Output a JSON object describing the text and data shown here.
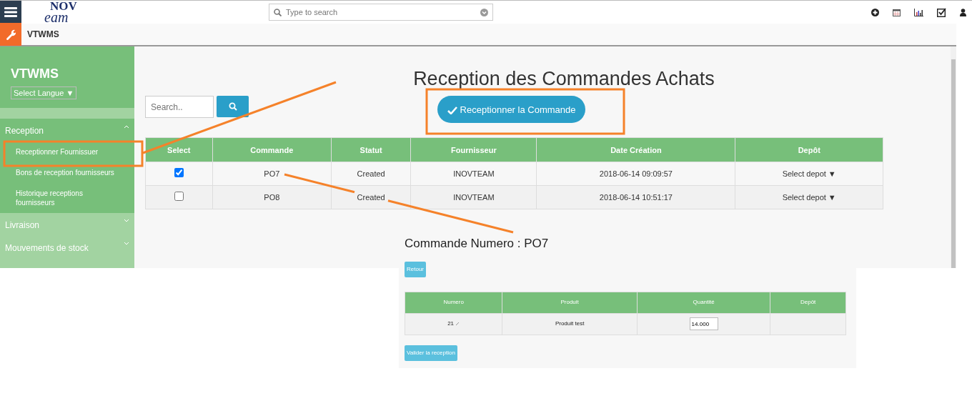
{
  "app": {
    "brand": "VTWMS",
    "logo_top": "NOV",
    "logo_bottom": "eam"
  },
  "search": {
    "placeholder": "Type to search"
  },
  "sidebar": {
    "title": "VTWMS",
    "language": "Select Langue ▼",
    "sections": [
      {
        "label": "Reception",
        "expanded": true,
        "children": [
          {
            "label": "Receptionner Fournissuer"
          },
          {
            "label": "Bons de reception fournisseurs"
          },
          {
            "label": "Historique receptions fournisseurs"
          }
        ]
      },
      {
        "label": "Livraison",
        "expanded": false
      },
      {
        "label": "Mouvements de stock",
        "expanded": false
      }
    ]
  },
  "page": {
    "title": "Reception des Commandes Achats",
    "search_placeholder": "Search..",
    "action": "Receptionner la Commande"
  },
  "orders": {
    "columns": [
      "Select",
      "Commande",
      "Statut",
      "Fournisseur",
      "Date Création",
      "Depôt"
    ],
    "rows": [
      {
        "checked": true,
        "commande": "PO7",
        "statut": "Created",
        "fournisseur": "INOVTEAM",
        "date": "2018-06-14 09:09:57",
        "depot": "Select depot ▼"
      },
      {
        "checked": false,
        "commande": "PO8",
        "statut": "Created",
        "fournisseur": "INOVTEAM",
        "date": "2018-06-14 10:51:17",
        "depot": "Select depot ▼"
      }
    ]
  },
  "detail": {
    "title": "Commande Numero : PO7",
    "back": "Retour",
    "columns": [
      "Numero",
      "Produit",
      "Quantité",
      "Depôt"
    ],
    "rows": [
      {
        "numero": "21",
        "produit": "Produit test",
        "quantite": "14.000"
      }
    ],
    "submit": "Valider la reception"
  }
}
